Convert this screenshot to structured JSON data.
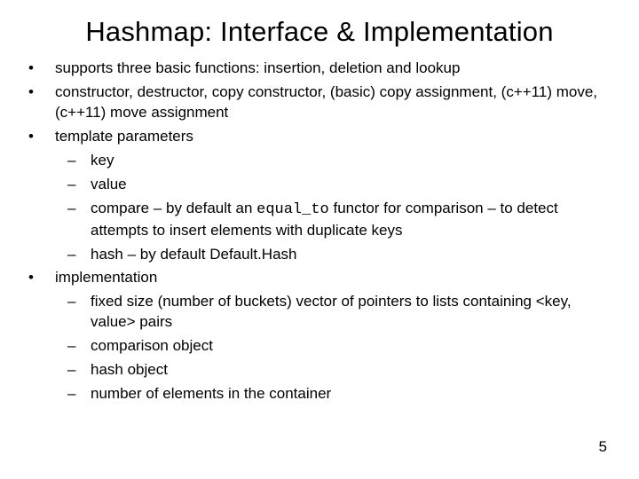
{
  "title": "Hashmap: Interface & Implementation",
  "bullets": {
    "b0": "supports three basic functions: insertion, deletion and lookup",
    "b1": "constructor, destructor, copy constructor, (basic) copy assignment, (c++11) move, (c++11) move assignment",
    "b2": "template parameters",
    "b2_sub": {
      "s0": "key",
      "s1": "value",
      "s2_pre": "compare – by default an ",
      "s2_code": "equal_to",
      "s2_post": " functor for comparison – to detect attempts to insert elements with duplicate keys",
      "s3": "hash – by default Default.Hash"
    },
    "b3": "implementation",
    "b3_sub": {
      "s0": "fixed size (number of buckets) vector of pointers to lists containing <key, value> pairs",
      "s1": "comparison object",
      "s2": "hash object",
      "s3": "number of elements in the container"
    }
  },
  "page_number": "5"
}
